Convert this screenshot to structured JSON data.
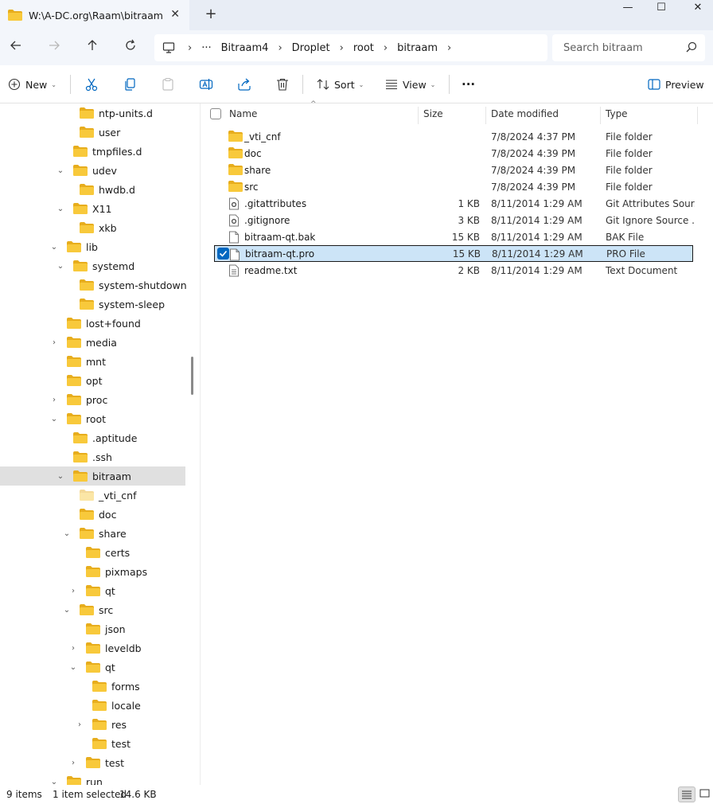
{
  "window": {
    "tab_title": "W:\\A-DC.org\\Raam\\bitraam\\s",
    "close_glyph": "✕",
    "new_tab_glyph": "+",
    "minimize_glyph": "—",
    "maximize_glyph": "☐",
    "close_window_glyph": "✕"
  },
  "address": {
    "overflow": "···",
    "crumbs": [
      "Bitraam4",
      "Droplet",
      "root",
      "bitraam"
    ],
    "separator": "›",
    "search_placeholder": "Search bitraam"
  },
  "toolbar": {
    "new_label": "New",
    "sort_label": "Sort",
    "view_label": "View",
    "more_label": "···",
    "preview_label": "Preview",
    "chevron": "⌄"
  },
  "sidebar": {
    "expanded_glyph": "⌄",
    "collapsed_glyph": "›",
    "items": [
      {
        "label": "ntp-units.d",
        "level": 3,
        "expander": ""
      },
      {
        "label": "user",
        "level": 3,
        "expander": ""
      },
      {
        "label": "tmpfiles.d",
        "level": 2,
        "expander": ""
      },
      {
        "label": "udev",
        "level": 2,
        "expander": "open"
      },
      {
        "label": "hwdb.d",
        "level": 3,
        "expander": ""
      },
      {
        "label": "X11",
        "level": 2,
        "expander": "open"
      },
      {
        "label": "xkb",
        "level": 3,
        "expander": ""
      },
      {
        "label": "lib",
        "level": 1,
        "expander": "open"
      },
      {
        "label": "systemd",
        "level": 2,
        "expander": "open"
      },
      {
        "label": "system-shutdown",
        "level": 3,
        "expander": ""
      },
      {
        "label": "system-sleep",
        "level": 3,
        "expander": ""
      },
      {
        "label": "lost+found",
        "level": 1,
        "expander": ""
      },
      {
        "label": "media",
        "level": 1,
        "expander": "closed"
      },
      {
        "label": "mnt",
        "level": 1,
        "expander": ""
      },
      {
        "label": "opt",
        "level": 1,
        "expander": ""
      },
      {
        "label": "proc",
        "level": 1,
        "expander": "closed"
      },
      {
        "label": "root",
        "level": 1,
        "expander": "open"
      },
      {
        "label": ".aptitude",
        "level": 2,
        "expander": ""
      },
      {
        "label": ".ssh",
        "level": 2,
        "expander": ""
      },
      {
        "label": "bitraam",
        "level": 2,
        "expander": "open",
        "selected": true
      },
      {
        "label": "_vti_cnf",
        "level": 3,
        "expander": "",
        "faded": true
      },
      {
        "label": "doc",
        "level": 3,
        "expander": ""
      },
      {
        "label": "share",
        "level": 3,
        "expander": "open"
      },
      {
        "label": "certs",
        "level": 4,
        "expander": ""
      },
      {
        "label": "pixmaps",
        "level": 4,
        "expander": ""
      },
      {
        "label": "qt",
        "level": 4,
        "expander": "closed"
      },
      {
        "label": "src",
        "level": 3,
        "expander": "open"
      },
      {
        "label": "json",
        "level": 4,
        "expander": ""
      },
      {
        "label": "leveldb",
        "level": 4,
        "expander": "closed"
      },
      {
        "label": "qt",
        "level": 4,
        "expander": "open"
      },
      {
        "label": "forms",
        "level": 5,
        "expander": ""
      },
      {
        "label": "locale",
        "level": 5,
        "expander": ""
      },
      {
        "label": "res",
        "level": 5,
        "expander": "closed"
      },
      {
        "label": "test",
        "level": 5,
        "expander": ""
      },
      {
        "label": "test",
        "level": 4,
        "expander": "closed"
      },
      {
        "label": "run",
        "level": 1,
        "expander": "open"
      }
    ]
  },
  "filelist": {
    "columns": {
      "name": "Name",
      "size": "Size",
      "date": "Date modified",
      "type": "Type"
    },
    "sort_caret": "^",
    "rows": [
      {
        "name": "_vti_cnf",
        "size": "",
        "date": "7/8/2024 4:37 PM",
        "type": "File folder",
        "icon": "folder-faded"
      },
      {
        "name": "doc",
        "size": "",
        "date": "7/8/2024 4:39 PM",
        "type": "File folder",
        "icon": "folder"
      },
      {
        "name": "share",
        "size": "",
        "date": "7/8/2024 4:39 PM",
        "type": "File folder",
        "icon": "folder"
      },
      {
        "name": "src",
        "size": "",
        "date": "7/8/2024 4:39 PM",
        "type": "File folder",
        "icon": "folder"
      },
      {
        "name": ".gitattributes",
        "size": "1 KB",
        "date": "8/11/2014 1:29 AM",
        "type": "Git Attributes Sour...",
        "icon": "settings-file"
      },
      {
        "name": ".gitignore",
        "size": "3 KB",
        "date": "8/11/2014 1:29 AM",
        "type": "Git Ignore Source ...",
        "icon": "settings-file"
      },
      {
        "name": "bitraam-qt.bak",
        "size": "15 KB",
        "date": "8/11/2014 1:29 AM",
        "type": "BAK File",
        "icon": "file"
      },
      {
        "name": "bitraam-qt.pro",
        "size": "15 KB",
        "date": "8/11/2014 1:29 AM",
        "type": "PRO File",
        "icon": "file",
        "selected": true
      },
      {
        "name": "readme.txt",
        "size": "2 KB",
        "date": "8/11/2014 1:29 AM",
        "type": "Text Document",
        "icon": "text-file"
      }
    ]
  },
  "status": {
    "items_count": "9 items",
    "selected": "1 item selected",
    "selected_size": "14.6 KB"
  },
  "colors": {
    "folder": "#f8c93b",
    "folder_dark": "#e7ad1d",
    "accent": "#0067c0",
    "selection": "#cce4f7"
  }
}
